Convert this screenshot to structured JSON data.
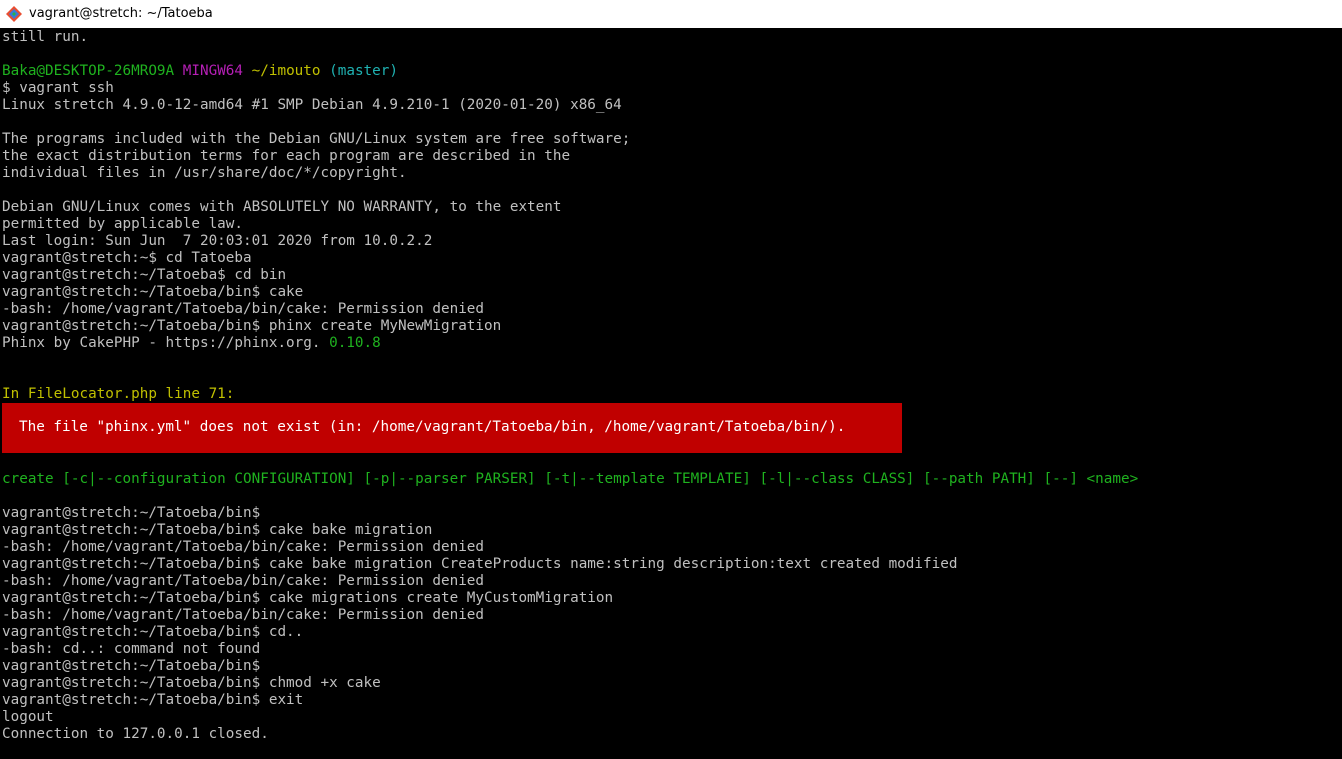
{
  "window": {
    "title": "vagrant@stretch: ~/Tatoeba",
    "icon": "git-bash-icon"
  },
  "colors": {
    "background": "#000000",
    "default_text": "#c0c0c0",
    "green": "#1fb21f",
    "magenta": "#b51fb5",
    "yellow": "#c0c000",
    "cyan": "#1fb2b2",
    "error_bg": "#c00000",
    "error_text": "#ffffff"
  },
  "terminal": {
    "lines": [
      [
        {
          "text": "still run.",
          "color": "default"
        }
      ],
      [
        {
          "text": "",
          "color": "default"
        }
      ],
      [
        {
          "text": "Baka@DESKTOP-26MRO9A ",
          "color": "green"
        },
        {
          "text": "MINGW64 ",
          "color": "magenta"
        },
        {
          "text": "~/imouto",
          "color": "yellow"
        },
        {
          "text": " (master)",
          "color": "cyan"
        }
      ],
      [
        {
          "text": "$ vagrant ssh",
          "color": "default"
        }
      ],
      [
        {
          "text": "Linux stretch 4.9.0-12-amd64 #1 SMP Debian 4.9.210-1 (2020-01-20) x86_64",
          "color": "default"
        }
      ],
      [
        {
          "text": "",
          "color": "default"
        }
      ],
      [
        {
          "text": "The programs included with the Debian GNU/Linux system are free software;",
          "color": "default"
        }
      ],
      [
        {
          "text": "the exact distribution terms for each program are described in the",
          "color": "default"
        }
      ],
      [
        {
          "text": "individual files in /usr/share/doc/*/copyright.",
          "color": "default"
        }
      ],
      [
        {
          "text": "",
          "color": "default"
        }
      ],
      [
        {
          "text": "Debian GNU/Linux comes with ABSOLUTELY NO WARRANTY, to the extent",
          "color": "default"
        }
      ],
      [
        {
          "text": "permitted by applicable law.",
          "color": "default"
        }
      ],
      [
        {
          "text": "Last login: Sun Jun  7 20:03:01 2020 from 10.0.2.2",
          "color": "default"
        }
      ],
      [
        {
          "text": "vagrant@stretch:~$ cd Tatoeba",
          "color": "default"
        }
      ],
      [
        {
          "text": "vagrant@stretch:~/Tatoeba$ cd bin",
          "color": "default"
        }
      ],
      [
        {
          "text": "vagrant@stretch:~/Tatoeba/bin$ cake",
          "color": "default"
        }
      ],
      [
        {
          "text": "-bash: /home/vagrant/Tatoeba/bin/cake: Permission denied",
          "color": "default"
        }
      ],
      [
        {
          "text": "vagrant@stretch:~/Tatoeba/bin$ phinx create MyNewMigration",
          "color": "default"
        }
      ],
      [
        {
          "text": "Phinx by CakePHP - https://phinx.org. ",
          "color": "default"
        },
        {
          "text": "0.10.8",
          "color": "green"
        }
      ],
      [
        {
          "text": "",
          "color": "default"
        }
      ],
      [
        {
          "text": "",
          "color": "default"
        }
      ],
      [
        {
          "text": "In FileLocator.php line 71:",
          "color": "yellow"
        }
      ],
      [
        {
          "text": "",
          "color": "default"
        }
      ],
      [
        {
          "text": "",
          "color": "default"
        }
      ],
      [
        {
          "text": "",
          "color": "default"
        }
      ],
      [
        {
          "text": "",
          "color": "default"
        }
      ],
      [
        {
          "text": "create [-c|--configuration CONFIGURATION] [-p|--parser PARSER] [-t|--template TEMPLATE] [-l|--class CLASS] [--path PATH] [--] <name>",
          "color": "green"
        }
      ],
      [
        {
          "text": "",
          "color": "default"
        }
      ],
      [
        {
          "text": "vagrant@stretch:~/Tatoeba/bin$",
          "color": "default"
        }
      ],
      [
        {
          "text": "vagrant@stretch:~/Tatoeba/bin$ cake bake migration",
          "color": "default"
        }
      ],
      [
        {
          "text": "-bash: /home/vagrant/Tatoeba/bin/cake: Permission denied",
          "color": "default"
        }
      ],
      [
        {
          "text": "vagrant@stretch:~/Tatoeba/bin$ cake bake migration CreateProducts name:string description:text created modified",
          "color": "default"
        }
      ],
      [
        {
          "text": "-bash: /home/vagrant/Tatoeba/bin/cake: Permission denied",
          "color": "default"
        }
      ],
      [
        {
          "text": "vagrant@stretch:~/Tatoeba/bin$ cake migrations create MyCustomMigration",
          "color": "default"
        }
      ],
      [
        {
          "text": "-bash: /home/vagrant/Tatoeba/bin/cake: Permission denied",
          "color": "default"
        }
      ],
      [
        {
          "text": "vagrant@stretch:~/Tatoeba/bin$ cd..",
          "color": "default"
        }
      ],
      [
        {
          "text": "-bash: cd..: command not found",
          "color": "default"
        }
      ],
      [
        {
          "text": "vagrant@stretch:~/Tatoeba/bin$",
          "color": "default"
        }
      ],
      [
        {
          "text": "vagrant@stretch:~/Tatoeba/bin$ chmod +x cake",
          "color": "default"
        }
      ],
      [
        {
          "text": "vagrant@stretch:~/Tatoeba/bin$ exit",
          "color": "default"
        }
      ],
      [
        {
          "text": "logout",
          "color": "default"
        }
      ],
      [
        {
          "text": "Connection to 127.0.0.1 closed.",
          "color": "default"
        }
      ]
    ],
    "error_message": "The file \"phinx.yml\" does not exist (in: /home/vagrant/Tatoeba/bin, /home/vagrant/Tatoeba/bin/)."
  }
}
